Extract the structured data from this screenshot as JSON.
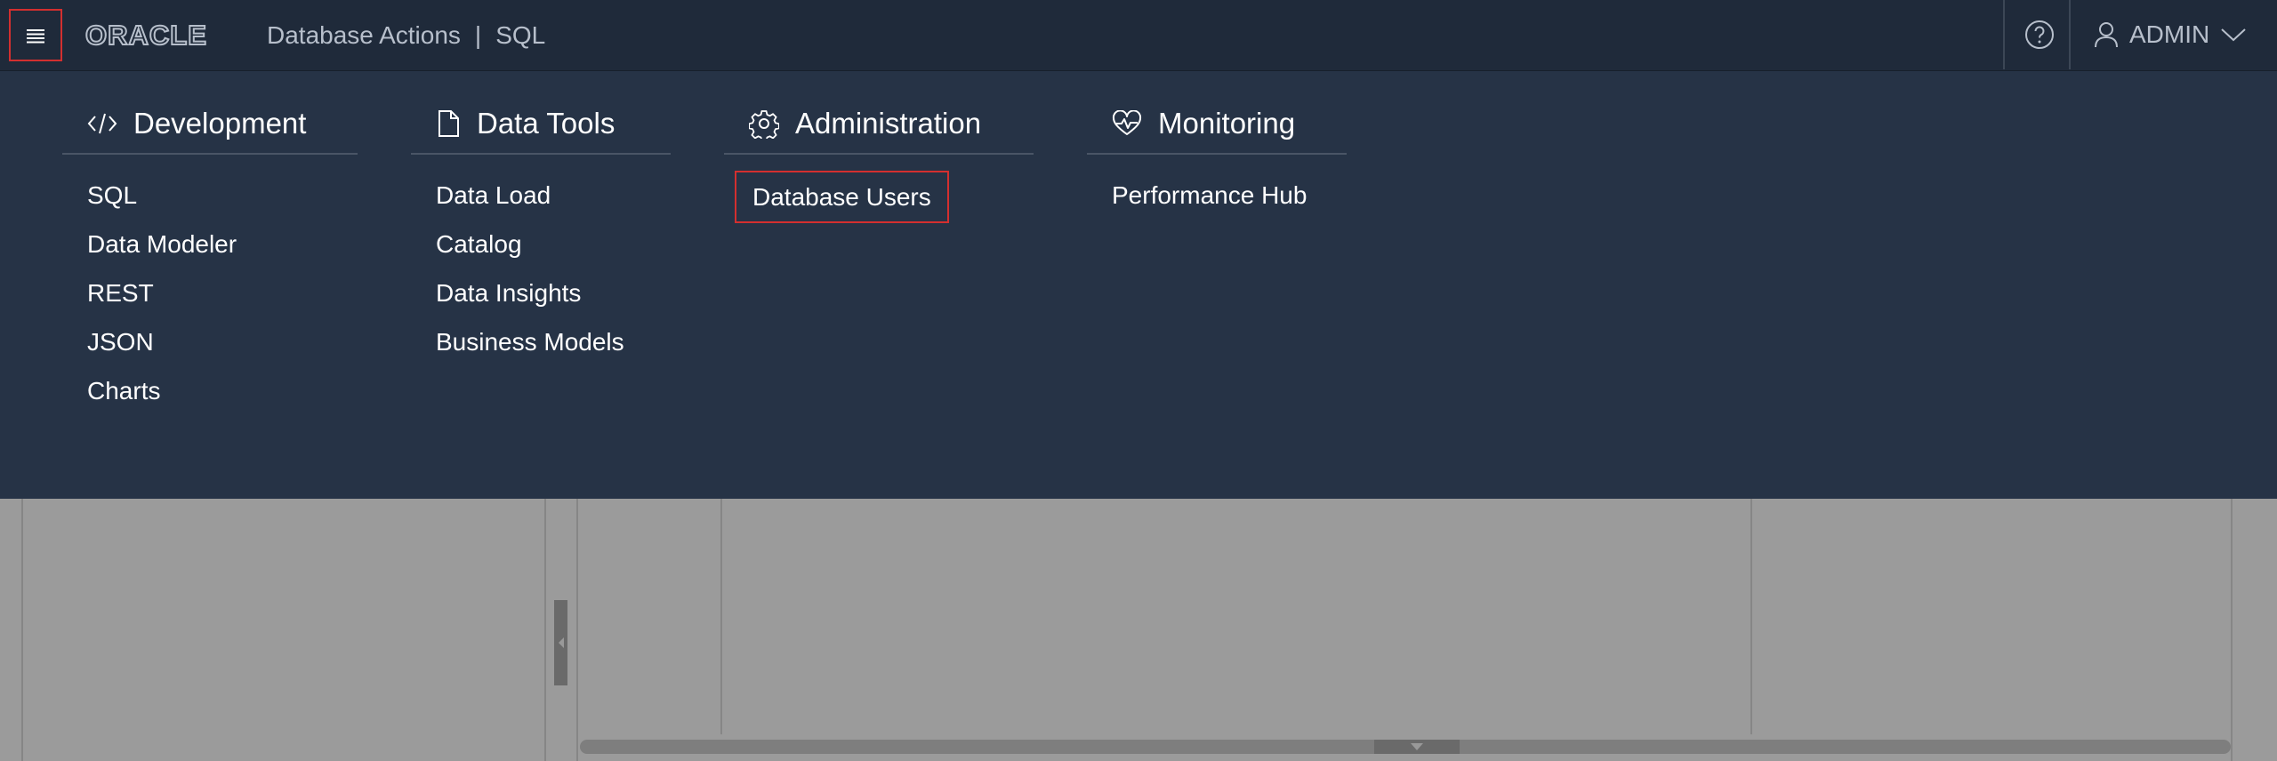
{
  "header": {
    "brand": "ORACLE",
    "app_name": "Database Actions",
    "separator": "|",
    "current_page": "SQL",
    "user": "ADMIN"
  },
  "nav": {
    "columns": [
      {
        "title": "Development",
        "icon": "code-icon",
        "items": [
          "SQL",
          "Data Modeler",
          "REST",
          "JSON",
          "Charts"
        ]
      },
      {
        "title": "Data Tools",
        "icon": "document-icon",
        "items": [
          "Data Load",
          "Catalog",
          "Data Insights",
          "Business Models"
        ]
      },
      {
        "title": "Administration",
        "icon": "gear-icon",
        "items": [
          "Database Users"
        ]
      },
      {
        "title": "Monitoring",
        "icon": "heart-pulse-icon",
        "items": [
          "Performance Hub"
        ]
      }
    ]
  },
  "colors": {
    "header_bg": "#1f2a3a",
    "panel_bg": "#263346",
    "highlight": "#d32f2f",
    "overlay": "#9a9a9a"
  }
}
